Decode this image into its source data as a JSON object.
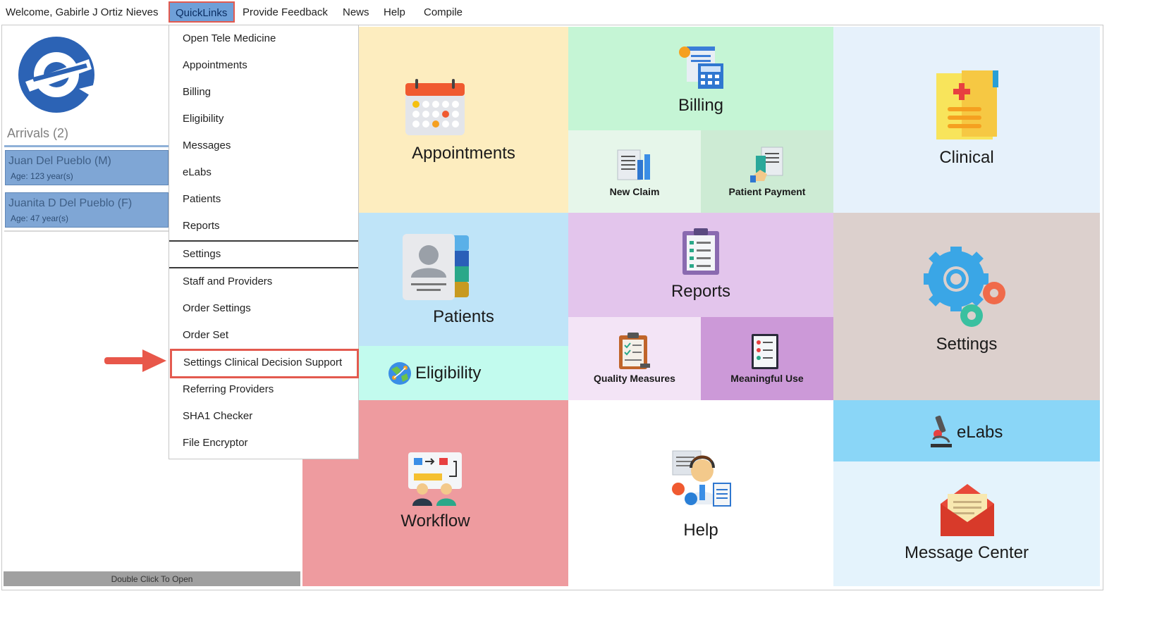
{
  "topbar": {
    "welcome": "Welcome, Gabirle J Ortiz Nieves",
    "quicklinks": "QuickLinks",
    "feedback": "Provide Feedback",
    "news": "News",
    "help": "Help",
    "compile": "Compile"
  },
  "sidebar": {
    "arrivals_title": "Arrivals (2)",
    "patients": [
      {
        "name": "Juan Del Pueblo (M)",
        "age": "Age: 123 year(s)"
      },
      {
        "name": "Juanita D Del Pueblo (F)",
        "age": "Age: 47 year(s)"
      }
    ],
    "footer": "Double Click To Open"
  },
  "quicklinks_menu": {
    "items": [
      "Open Tele Medicine",
      "Appointments",
      "Billing",
      "Eligibility",
      "Messages",
      "eLabs",
      "Patients",
      "Reports",
      "Settings",
      "Staff and Providers",
      "Order Settings",
      "Order Set",
      "Settings Clinical Decision Support",
      "Referring Providers",
      "SHA1 Checker",
      "File Encryptor"
    ]
  },
  "tiles": {
    "appointments": "Appointments",
    "billing": "Billing",
    "new_claim": "New Claim",
    "patient_payment": "Patient Payment",
    "clinical": "Clinical",
    "patients": "Patients",
    "eligibility": "Eligibility",
    "reports": "Reports",
    "quality_measures": "Quality Measures",
    "meaningful_use": "Meaningful Use",
    "settings": "Settings",
    "elabs": "eLabs",
    "workflow": "Workflow",
    "help": "Help",
    "message_center": "Message Center"
  },
  "colors": {
    "highlight_border": "#e35a4f",
    "quicklinks_bg": "#6fa0d8",
    "patient_card": "#7fa6d5",
    "appointments_tile": "#fdedbf",
    "billing_tile": "#c5f5d5",
    "clinical_tile": "#e6f1fb",
    "patients_tile": "#bfe4f8",
    "eligibility_tile": "#c2fbee",
    "reports_tile": "#e3c5ec",
    "settings_tile": "#dcd0cd",
    "elabs_tile": "#8ad6f7",
    "workflow_tile": "#ee9b9f",
    "message_center_tile": "#e4f3fc"
  }
}
